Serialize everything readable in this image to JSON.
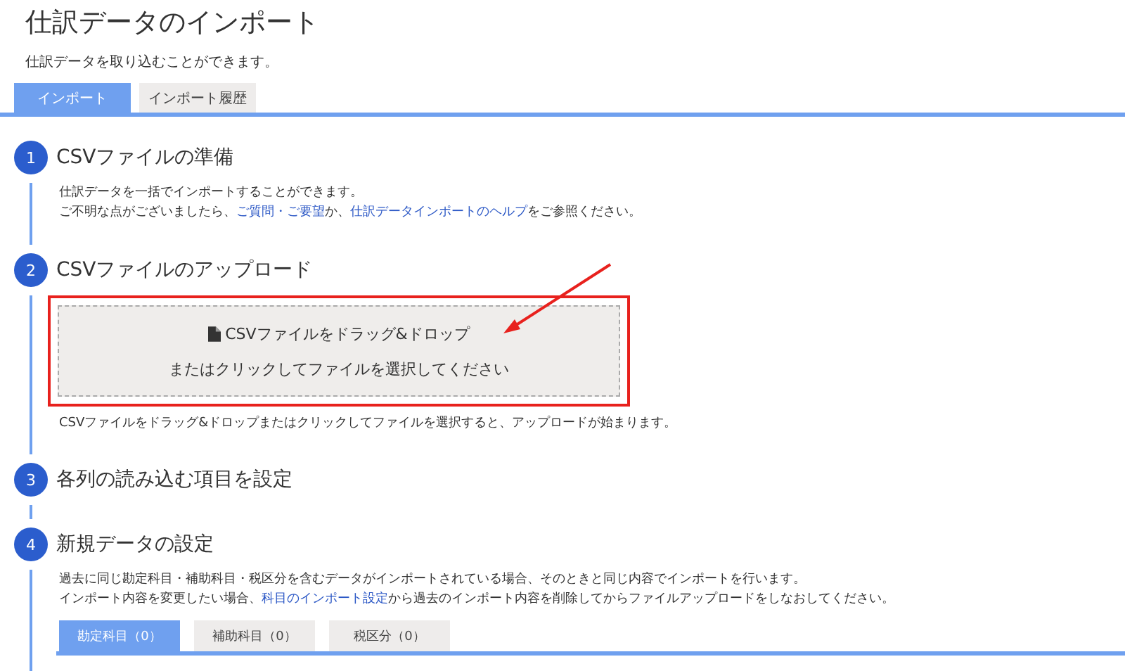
{
  "title": "仕訳データのインポート",
  "subtitle": "仕訳データを取り込むことができます。",
  "tabs": [
    {
      "label": "インポート",
      "selected": true
    },
    {
      "label": "インポート履歴",
      "selected": false
    }
  ],
  "steps": [
    {
      "number": "1",
      "heading": "CSVファイルの準備",
      "kind": "text",
      "lines": [
        [
          {
            "text": "仕訳データを一括でインポートすることができます。",
            "link": false
          }
        ],
        [
          {
            "text": "ご不明な点がございましたら、",
            "link": false
          },
          {
            "text": "ご質問・ご要望",
            "link": true
          },
          {
            "text": "か、",
            "link": false
          },
          {
            "text": "仕訳データインポートのヘルプ",
            "link": true
          },
          {
            "text": "をご参照ください。",
            "link": false
          }
        ]
      ]
    },
    {
      "number": "2",
      "heading": "CSVファイルのアップロード",
      "kind": "upload",
      "highlighted": true,
      "drop_title": "CSVファイルをドラッグ&ドロップ",
      "drop_sub": "またはクリックしてファイルを選択してください",
      "caption": "CSVファイルをドラッグ&ドロップまたはクリックしてファイルを選択すると、アップロードが始まります。"
    },
    {
      "number": "3",
      "heading": "各列の読み込む項目を設定",
      "kind": "empty"
    },
    {
      "number": "4",
      "heading": "新規データの設定",
      "kind": "tabs",
      "lines": [
        [
          {
            "text": "過去に同じ勘定科目・補助科目・税区分を含むデータがインポートされている場合、そのときと同じ内容でインポートを行います。",
            "link": false
          }
        ],
        [
          {
            "text": "インポート内容を変更したい場合、",
            "link": false
          },
          {
            "text": "科目のインポート設定",
            "link": true
          },
          {
            "text": "から過去のインポート内容を削除してからファイルアップロードをしなおしてください。",
            "link": false
          }
        ]
      ],
      "tabs": [
        {
          "label": "勘定科目（0）",
          "selected": true
        },
        {
          "label": "補助科目（0）",
          "selected": false
        },
        {
          "label": "税区分（0）",
          "selected": false
        }
      ]
    }
  ]
}
